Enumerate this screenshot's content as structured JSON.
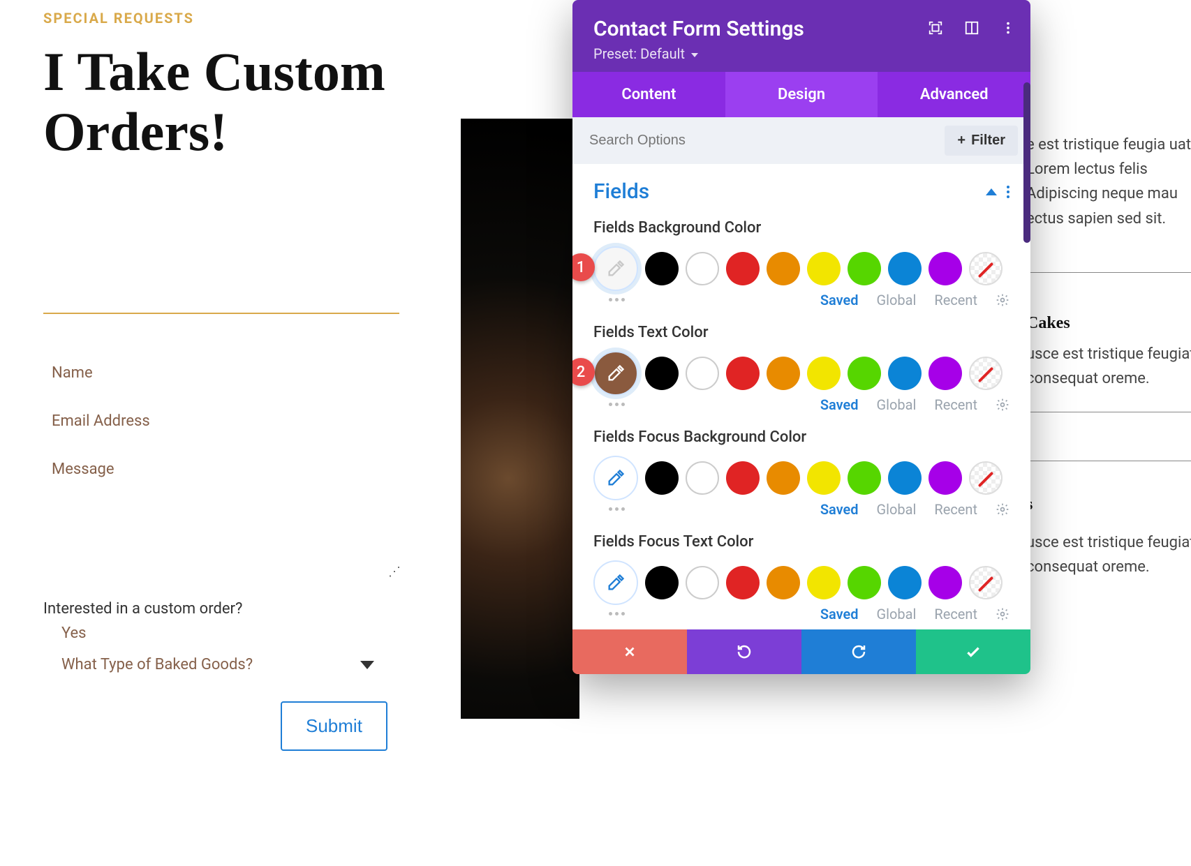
{
  "page": {
    "eyebrow": "SPECIAL REQUESTS",
    "heading": "I Take Custom Orders!",
    "form": {
      "name": "Name",
      "email": "Email Address",
      "message": "Message",
      "q_interest": "Interested in a custom order?",
      "a_interest": "Yes",
      "q_type": "What Type of Baked Goods?",
      "submit": "Submit"
    },
    "right": {
      "p1": "e est tristique feugia uat. Lorem lectus felis Adipiscing neque mau ectus sapien sed sit.",
      "sub1": "Cakes",
      "p2": "usce est tristique feugiat consequat oreme.",
      "sub2": "s",
      "p3": "usce est tristique feugiat consequat oreme."
    }
  },
  "panel": {
    "title": "Contact Form Settings",
    "preset": "Preset: Default",
    "tabs": {
      "content": "Content",
      "design": "Design",
      "advanced": "Advanced"
    },
    "search_placeholder": "Search Options",
    "filter": "Filter",
    "section": "Fields",
    "tabs_bottom": {
      "saved": "Saved",
      "global": "Global",
      "recent": "Recent"
    },
    "options": [
      {
        "label": "Fields Background Color",
        "current": "white",
        "badge": "1",
        "selected": true
      },
      {
        "label": "Fields Text Color",
        "current": "brown",
        "badge": "2",
        "selected": true
      },
      {
        "label": "Fields Focus Background Color",
        "current": "blue-eyedrop",
        "badge": null,
        "selected": false
      },
      {
        "label": "Fields Focus Text Color",
        "current": "blue-eyedrop",
        "badge": null,
        "selected": false
      }
    ],
    "palette": [
      "black",
      "white",
      "red",
      "orange",
      "yellow",
      "green",
      "blue",
      "purple",
      "transparent"
    ]
  }
}
